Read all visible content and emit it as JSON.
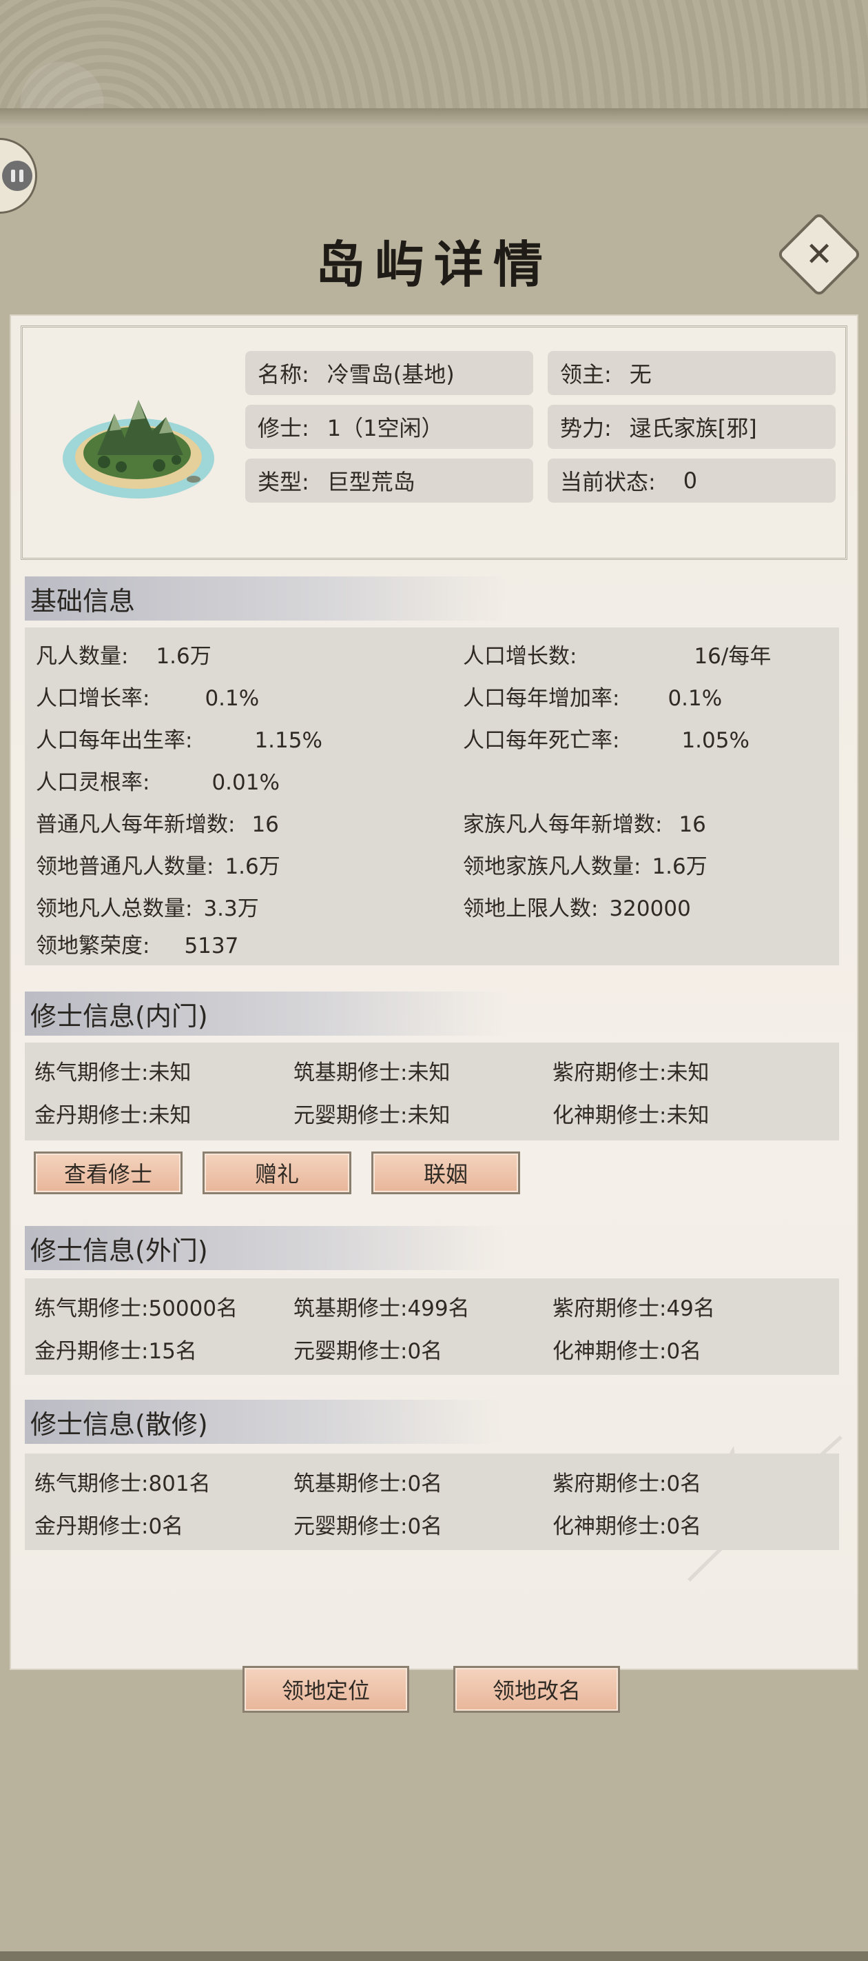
{
  "title": "岛屿详情",
  "island": {
    "name_label": "名称:",
    "name_value": "冷雪岛(基地)",
    "lord_label": "领主:",
    "lord_value": "无",
    "cultivator_label": "修士:",
    "cultivator_value": "1（1空闲）",
    "faction_label": "势力:",
    "faction_value": "逯氏家族[邪]",
    "type_label": "类型:",
    "type_value": "巨型荒岛",
    "status_label": "当前状态:",
    "status_value": "0"
  },
  "basic": {
    "header": "基础信息",
    "rows": [
      {
        "l_label": "凡人数量:",
        "l_value": "1.6万",
        "r_label": "人口增长数:",
        "r_value": "16/每年"
      },
      {
        "l_label": "人口增长率:",
        "l_value": "0.1%",
        "r_label": "人口每年增加率:",
        "r_value": "0.1%"
      },
      {
        "l_label": "人口每年出生率:",
        "l_value": "1.15%",
        "r_label": "人口每年死亡率:",
        "r_value": "1.05%"
      },
      {
        "l_label": "人口灵根率:",
        "l_value": "0.01%",
        "r_label": "",
        "r_value": ""
      },
      {
        "l_label": "普通凡人每年新增数:",
        "l_value": "16",
        "r_label": "家族凡人每年新增数:",
        "r_value": "16"
      },
      {
        "l_label": "领地普通凡人数量:",
        "l_value": "1.6万",
        "r_label": "领地家族凡人数量:",
        "r_value": "1.6万"
      },
      {
        "l_label": "领地凡人总数量:",
        "l_value": "3.3万",
        "r_label": "领地上限人数:",
        "r_value": "320000"
      },
      {
        "l_label": "领地繁荣度:",
        "l_value": "5137",
        "r_label": "",
        "r_value": ""
      }
    ]
  },
  "inner": {
    "header": "修士信息(内门)",
    "cells": [
      "练气期修士:未知",
      "筑基期修士:未知",
      "紫府期修士:未知",
      "金丹期修士:未知",
      "元婴期修士:未知",
      "化神期修士:未知"
    ],
    "buttons": [
      "查看修士",
      "赠礼",
      "联姻"
    ]
  },
  "outer": {
    "header": "修士信息(外门)",
    "cells": [
      "练气期修士:50000名",
      "筑基期修士:499名",
      "紫府期修士:49名",
      "金丹期修士:15名",
      "元婴期修士:0名",
      "化神期修士:0名"
    ]
  },
  "rogue": {
    "header": "修士信息(散修)",
    "cells": [
      "练气期修士:801名",
      "筑基期修士:0名",
      "紫府期修士:0名",
      "金丹期修士:0名",
      "元婴期修士:0名",
      "化神期修士:0名"
    ]
  },
  "footer": {
    "locate": "领地定位",
    "rename": "领地改名"
  },
  "icons": {
    "back": "back-icon",
    "close": "close-icon"
  }
}
